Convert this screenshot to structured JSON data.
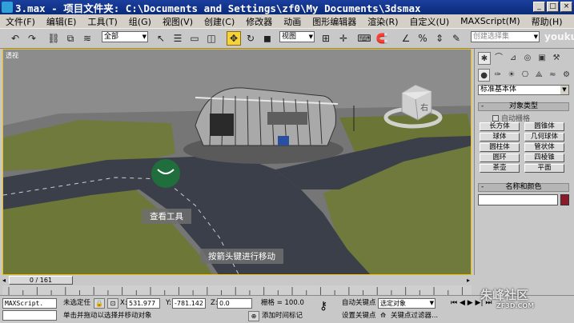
{
  "window": {
    "title": "3.max    - 项目文件夹: C:\\Documents and Settings\\zf0\\My Documents\\3dsmax",
    "controls": [
      "_",
      "□",
      "×"
    ]
  },
  "menu": [
    "文件(F)",
    "编辑(E)",
    "工具(T)",
    "组(G)",
    "视图(V)",
    "创建(C)",
    "修改器",
    "动画",
    "图形编辑器",
    "渲染(R)",
    "自定义(U)",
    "MAXScript(M)",
    "帮助(H)"
  ],
  "toolbar": {
    "selection_filter": "全部",
    "ref_coord": "视图",
    "named_selection_placeholder": "创建选择集"
  },
  "viewport": {
    "label": "透视",
    "tooltip_view_tool": "查看工具",
    "tooltip_arrow_move": "按箭头键进行移动",
    "viewcube_label": "右"
  },
  "command_panel": {
    "category": "标准基本体",
    "object_type_header": "对象类型",
    "auto_grid": "自动栅格",
    "objects": [
      "长方体",
      "圆锥体",
      "球体",
      "几何球体",
      "圆柱体",
      "管状体",
      "圆环",
      "四棱锥",
      "茶壶",
      "平面"
    ],
    "name_color_header": "名称和颜色",
    "name_value": ""
  },
  "timeline": {
    "frame_display": "0 / 161",
    "ticks": [
      "0",
      "10",
      "20",
      "30",
      "40",
      "50",
      "60",
      "70",
      "80",
      "90",
      "100",
      "110",
      "120",
      "130",
      "140",
      "150",
      "160"
    ]
  },
  "status": {
    "maxscript_label": "MAXScript.",
    "selection_state": "未选定任",
    "prompt": "单击并拖动以选择并移动对象",
    "x_label": "X:",
    "x_value": "531.977",
    "y_label": "Y:",
    "y_value": "-781.142",
    "z_label": "Z:",
    "z_value": "0.0",
    "grid_label": "栅格 = 100.0",
    "add_time_tag": "添加时间标记",
    "auto_key": "自动关键点",
    "auto_key_select": "选定对象",
    "set_key": "设置关键点",
    "key_filters": "关键点过滤器..."
  },
  "watermark": {
    "site_name": "朱峰社区",
    "site_url": "ZF3D.COM",
    "corner_text": "youku"
  },
  "colors": {
    "titlebar": "#0b2a7a",
    "active_tool": "#f6d23c",
    "viewport_border": "#f2c200",
    "color_swatch": "#8b1a2b"
  }
}
